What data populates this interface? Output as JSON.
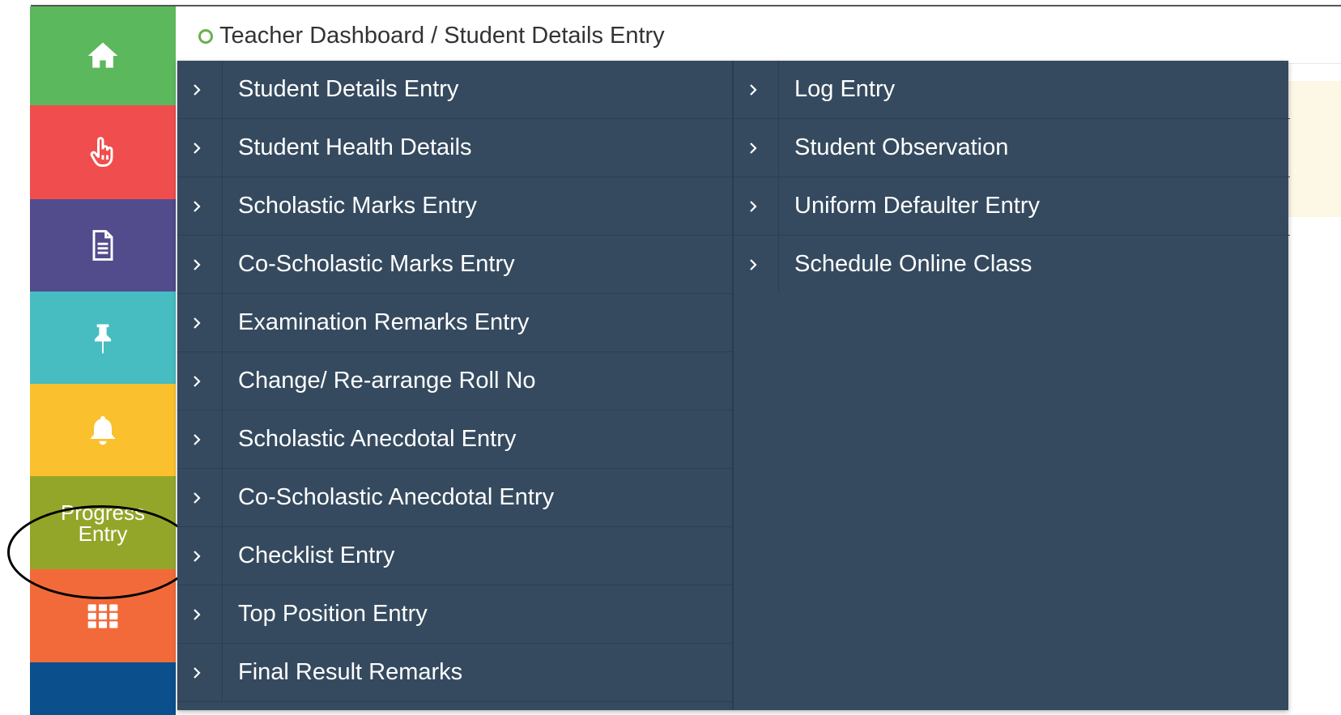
{
  "breadcrumb": {
    "text": "Teacher Dashboard / Student Details Entry"
  },
  "sidebar": {
    "colors": [
      "#5cb85c",
      "#f04e4e",
      "#524b8c",
      "#47bcc1",
      "#fbc02d",
      "#94a629",
      "#f26a3a",
      "#0b4f8c"
    ],
    "progress_label_line1": "Progress",
    "progress_label_line2": "Entry"
  },
  "menu": {
    "column1": [
      "Student Details Entry",
      "Student Health Details",
      "Scholastic Marks Entry",
      "Co-Scholastic Marks Entry",
      "Examination Remarks Entry",
      "Change/ Re-arrange Roll No",
      "Scholastic Anecdotal Entry",
      "Co-Scholastic Anecdotal Entry",
      "Checklist Entry",
      "Top Position Entry",
      "Final Result Remarks"
    ],
    "column2": [
      "Log Entry",
      "Student Observation",
      "Uniform Defaulter Entry",
      "Schedule Online Class"
    ]
  }
}
